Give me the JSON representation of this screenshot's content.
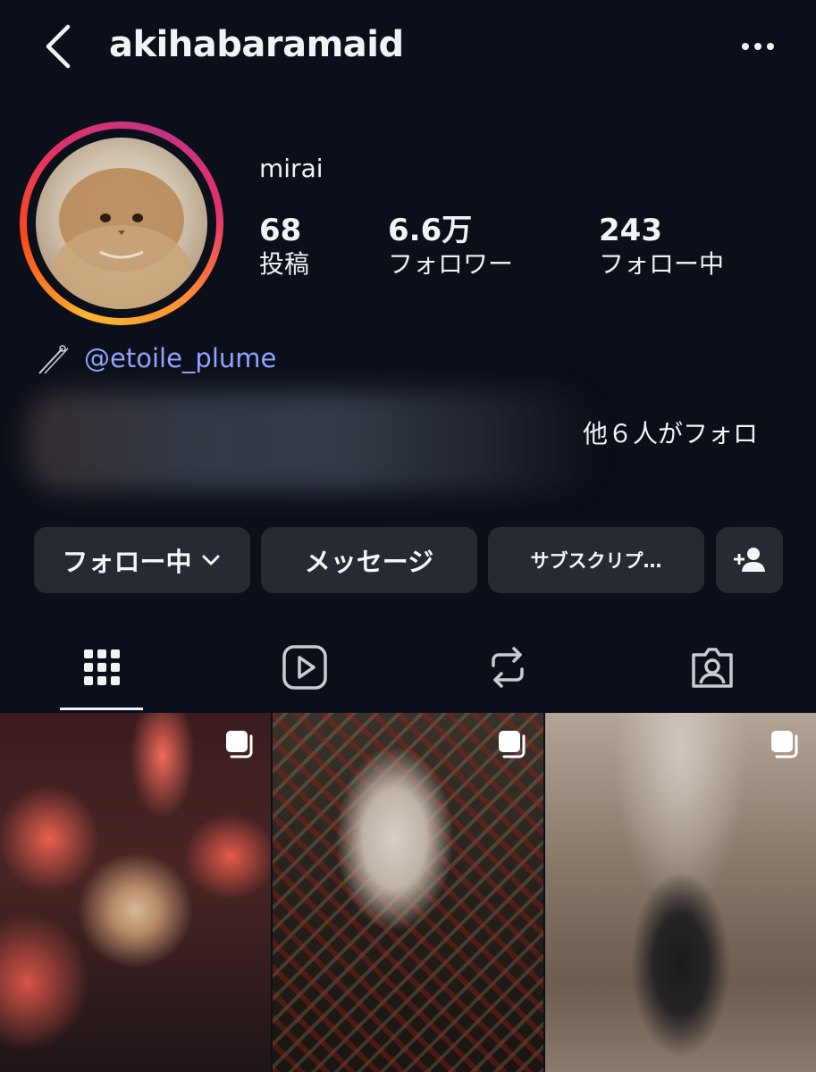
{
  "header": {
    "username": "akihabaramaid"
  },
  "profile": {
    "display_name": "mirai",
    "stats": [
      {
        "value": "68",
        "label": "投稿"
      },
      {
        "value": "6.6万",
        "label": "フォロワー"
      },
      {
        "value": "243",
        "label": "フォロー中"
      }
    ],
    "link": "@etoile_plume",
    "followed_by": "他６人がフォロ"
  },
  "buttons": {
    "following": "フォロー中",
    "message": "メッセージ",
    "subscribe": "サブスクリプ…"
  },
  "tabs": [
    "grid-icon",
    "reels-icon",
    "reposts-icon",
    "tagged-icon"
  ],
  "colors": {
    "background": "#0b0f19",
    "button": "#262a33",
    "link": "#8fa3ff"
  }
}
